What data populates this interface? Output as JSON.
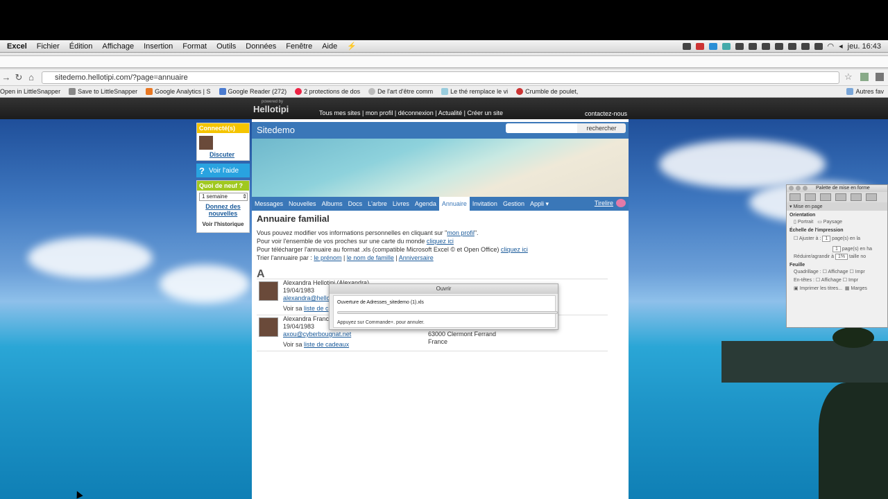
{
  "menubar": {
    "items": [
      "Excel",
      "Fichier",
      "Édition",
      "Affichage",
      "Insertion",
      "Format",
      "Outils",
      "Données",
      "Fenêtre",
      "Aide"
    ],
    "clock": "jeu. 16:43"
  },
  "browser": {
    "url": "sitedemo.hellotipi.com/?page=annuaire",
    "bookmarks": [
      "Open in LittleSnapper",
      "Save to LittleSnapper",
      "Google Analytics | S",
      "Google Reader (272)",
      "2 protections de dos",
      "De l'art d'être comm",
      "Le thé remplace le vi",
      "Crumble de poulet, "
    ],
    "other_bookmarks": "Autres fav"
  },
  "hellotipi": {
    "powered": "powered by",
    "logo": "Hellotipi",
    "links": "Tous mes sites | mon profil | déconnexion | Actualité | Créer un site",
    "contact": "contactez-nous"
  },
  "widgets": {
    "connect_title": "Connecté(s)",
    "discuss": "Discuter",
    "help": "Voir l'aide",
    "news_title": "Quoi de neuf ?",
    "period": "1 semaine",
    "give_news": "Donnez des nouvelles",
    "history": "Voir l'historique"
  },
  "site": {
    "title": "Sitedemo",
    "search_button": "rechercher",
    "tabs": [
      "Messages",
      "Nouvelles",
      "Albums",
      "Docs",
      "L'arbre",
      "Livres",
      "Agenda",
      "Annuaire",
      "Invitation",
      "Gestion",
      "Appli ▾"
    ],
    "active_tab": "Annuaire",
    "tirelire": "Tirelire"
  },
  "annuaire": {
    "heading": "Annuaire familial",
    "line1_pre": "Vous pouvez modifier vos informations personnelles en cliquant sur \"",
    "line1_link": "mon profil",
    "line1_post": "\".",
    "line2_pre": "Pour voir l'ensemble de vos proches sur une carte du monde",
    "line2_link": "cliquez ici",
    "line3_pre": "Pour télécharger l'annuaire au format .xls (compatible Microsoft Excel © et Open Office)",
    "line3_link": "cliquez ici",
    "sort_pre": "Trier l'annuaire par :",
    "sort_options": [
      "le prénom",
      "le nom de famille",
      "Anniversaire"
    ],
    "letter": "A",
    "entries": [
      {
        "name": "Alexandra Hellotipi (Alexandra)",
        "date": "19/04/1983",
        "email": "alexandra@hello",
        "gift_pre": "Voir sa",
        "gift_link": "liste de c",
        "city": "",
        "country": ""
      },
      {
        "name": "Alexandra Franc",
        "date": "19/04/1983",
        "email": "axou@cyberbougnat.net",
        "gift_pre": "Voir sa",
        "gift_link": "liste de cadeaux",
        "city": "63000 Clermont Ferrand",
        "country": "France"
      }
    ]
  },
  "dialog": {
    "title": "Ouvrir",
    "file": "Ouverture de Adresses_sitedemo (1).xls",
    "hint": "Appuyez sur Commande+. pour annuler.",
    "progress": 0.0
  },
  "palette": {
    "title": "Palette de mise en forme",
    "section": "Mise en page",
    "orientation": "Orientation",
    "portrait": "Portrait",
    "paysage": "Paysage",
    "scale": "Échelle de l'impression",
    "fit": "Ajuster à :",
    "fit_w": "1",
    "fit_h": "1",
    "pages_w": "page(s) en la",
    "pages_h": "page(s) en ha",
    "reduce": "Réduire/agrandir à",
    "reduce_val": "1%",
    "size": "taille no",
    "sheet": "Feuille",
    "grid": "Quadrillage :",
    "heads": "En-têtes :",
    "display": "Affichage",
    "print": "Impr",
    "print_titles": "Imprimer les titres...",
    "margins": "Marges"
  }
}
